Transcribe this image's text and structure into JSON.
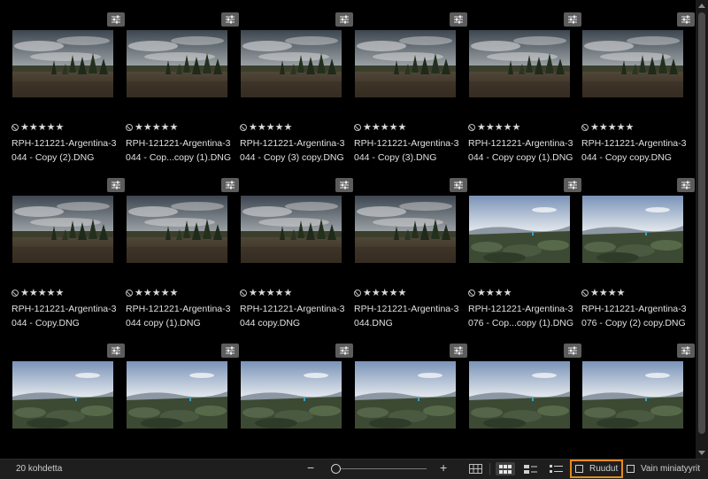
{
  "grid": {
    "items": [
      {
        "name": "RPH-121221-Argentina-3\n044 - Copy (2).DNG",
        "stars": "★★★★★",
        "scene": "field"
      },
      {
        "name": "RPH-121221-Argentina-3\n044 - Cop...copy (1).DNG",
        "stars": "★★★★★",
        "scene": "field"
      },
      {
        "name": "RPH-121221-Argentina-3\n044 - Copy (3) copy.DNG",
        "stars": "★★★★★",
        "scene": "field"
      },
      {
        "name": "RPH-121221-Argentina-3\n044 - Copy (3).DNG",
        "stars": "★★★★★",
        "scene": "field"
      },
      {
        "name": "RPH-121221-Argentina-3\n044 - Copy copy (1).DNG",
        "stars": "★★★★★",
        "scene": "field"
      },
      {
        "name": "RPH-121221-Argentina-3\n044 - Copy copy.DNG",
        "stars": "★★★★★",
        "scene": "field"
      },
      {
        "name": "RPH-121221-Argentina-3\n044 - Copy.DNG",
        "stars": "★★★★★",
        "scene": "field"
      },
      {
        "name": "RPH-121221-Argentina-3\n044 copy (1).DNG",
        "stars": "★★★★★",
        "scene": "field"
      },
      {
        "name": "RPH-121221-Argentina-3\n044 copy.DNG",
        "stars": "★★★★★",
        "scene": "field"
      },
      {
        "name": "RPH-121221-Argentina-3\n044.DNG",
        "stars": "★★★★★",
        "scene": "field"
      },
      {
        "name": "RPH-121221-Argentina-3\n076 - Cop...copy (1).DNG",
        "stars": "★★★★",
        "scene": "mountain"
      },
      {
        "name": "RPH-121221-Argentina-3\n076 - Copy (2) copy.DNG",
        "stars": "★★★★",
        "scene": "mountain"
      },
      {
        "name": "",
        "stars": "",
        "scene": "mountain"
      },
      {
        "name": "",
        "stars": "",
        "scene": "mountain"
      },
      {
        "name": "",
        "stars": "",
        "scene": "mountain"
      },
      {
        "name": "",
        "stars": "",
        "scene": "mountain"
      },
      {
        "name": "",
        "stars": "",
        "scene": "mountain"
      },
      {
        "name": "",
        "stars": "",
        "scene": "mountain"
      }
    ]
  },
  "statusbar": {
    "count_label": "20 kohdetta",
    "zoom_minus": "−",
    "zoom_plus": "+",
    "zoom_level": 0.0,
    "tiles_label": "Ruudut",
    "tiles_checked": false,
    "thumbs_only_label": "Vain miniatyyrit",
    "thumbs_only_checked": false
  }
}
